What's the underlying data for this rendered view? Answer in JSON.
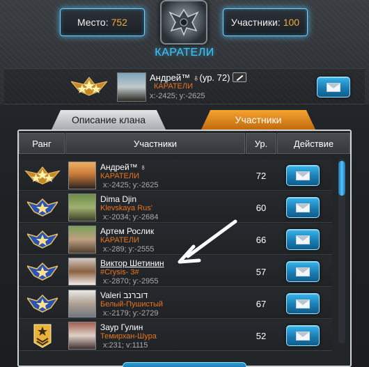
{
  "header": {
    "place_label": "Место:",
    "place_value": "752",
    "members_label": "Участники:",
    "members_value": "100",
    "clan_name": "КАРАТЕЛИ"
  },
  "leader": {
    "name": "Андрей™ ♁(ур. 72)",
    "clan": "КАРАТЕЛИ",
    "coords": "x:-2425; y:-2625"
  },
  "tabs": [
    {
      "label": "Описание клана",
      "active": false
    },
    {
      "label": "Участники",
      "active": true
    }
  ],
  "table": {
    "headers": [
      "Ранг",
      "Участники",
      "Ур.",
      "Действие"
    ],
    "rows": [
      {
        "rank_icon": "leader-three-star-badge",
        "name": "Андрей™ ♁",
        "clan": "КАРАТЕЛИ",
        "coords": "x:-2425; y:-2625",
        "level": "72"
      },
      {
        "rank_icon": "officer-star-badge",
        "name": "Dima Djin",
        "clan": "Klevskaya Rus'",
        "coords": "x:-2034; y:-2684",
        "level": "60"
      },
      {
        "rank_icon": "officer-star-badge",
        "name": "Артем Рослик",
        "clan": "КАРАТЕЛИ",
        "coords": "x:-289; y:-2555",
        "level": "66"
      },
      {
        "rank_icon": "officer-star-badge",
        "name": "Виктор Шетинин",
        "clan": "#Crysis- 3#",
        "coords": "x:-2870; y:-2955",
        "level": "57"
      },
      {
        "rank_icon": "officer-star-badge",
        "name": "Valeri דוברנב",
        "clan": "Белый-Пушистый",
        "coords": "x:-2179; y:-2729",
        "level": "67"
      },
      {
        "rank_icon": "sergeant-chevron-badge",
        "name": "Заур Гулин",
        "clan": "Темирхан-Шура",
        "coords": "x:231; v:1115",
        "level": "52"
      }
    ]
  },
  "colors": {
    "accent_blue": "#38c8ff",
    "clan_orange": "#e8741f",
    "tab_active": "#f4a431"
  }
}
